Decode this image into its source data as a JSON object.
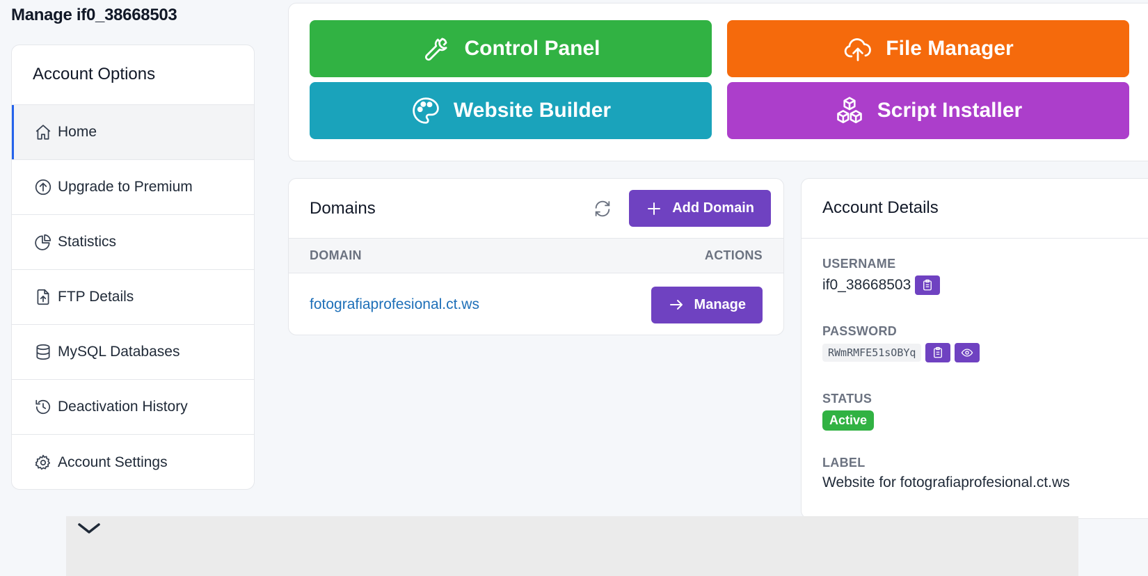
{
  "page": {
    "title": "Manage if0_38668503"
  },
  "sidebar": {
    "header": "Account Options",
    "items": [
      {
        "label": "Home",
        "icon": "home-icon"
      },
      {
        "label": "Upgrade to Premium",
        "icon": "arrow-up-circle-icon"
      },
      {
        "label": "Statistics",
        "icon": "pie-chart-icon"
      },
      {
        "label": "FTP Details",
        "icon": "file-upload-icon"
      },
      {
        "label": "MySQL Databases",
        "icon": "database-icon"
      },
      {
        "label": "Deactivation History",
        "icon": "history-icon"
      },
      {
        "label": "Account Settings",
        "icon": "gear-icon"
      }
    ]
  },
  "tools": {
    "control_panel": "Control Panel",
    "file_manager": "File Manager",
    "website_builder": "Website Builder",
    "script_installer": "Script Installer"
  },
  "domains": {
    "title": "Domains",
    "add_label": "Add Domain",
    "col_domain": "DOMAIN",
    "col_actions": "ACTIONS",
    "rows": [
      {
        "domain": "fotografiaprofesional.ct.ws",
        "action": "Manage"
      }
    ]
  },
  "details": {
    "title": "Account Details",
    "username_label": "USERNAME",
    "username": "if0_38668503",
    "password_label": "PASSWORD",
    "password": "RWmRMFE51sOBYq",
    "status_label": "STATUS",
    "status": "Active",
    "label_label": "LABEL",
    "label_value": "Website for fotografiaprofesional.ct.ws"
  },
  "colors": {
    "green": "#31b243",
    "orange": "#f56a0c",
    "teal": "#1aa3bb",
    "magenta": "#ac3ecb",
    "purple": "#6f42c1",
    "link": "#1d6fb8",
    "active_indicator": "#2563eb"
  }
}
